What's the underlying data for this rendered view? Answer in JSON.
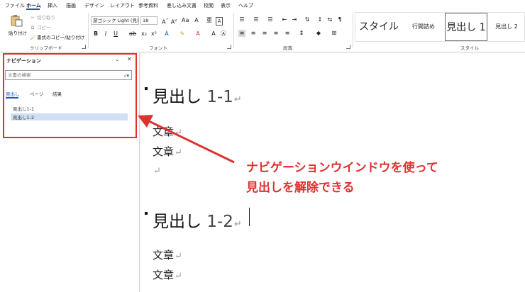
{
  "menu": {
    "tabs": [
      "ファイル",
      "ホーム",
      "挿入",
      "描画",
      "デザイン",
      "レイアウト",
      "参考資料",
      "差し込み文書",
      "校閲",
      "表示",
      "ヘルプ"
    ],
    "active_tab": "ホーム"
  },
  "clipboard": {
    "paste_label": "貼り付け",
    "cut_label": "切り取り",
    "copy_label": "コピー",
    "format_painter_label": "書式のコピー/貼り付け",
    "group_label": "クリップボード"
  },
  "font": {
    "font_name": "游ゴシック Light (見)",
    "font_size": "18",
    "group_label": "フォント"
  },
  "paragraph": {
    "group_label": "段落"
  },
  "styles": {
    "group_label": "スタイル",
    "items": [
      "スタイル",
      "行間詰め",
      "見出し 1",
      "見出し 2"
    ],
    "selected": "見出し 1"
  },
  "navigation": {
    "title": "ナビゲーション",
    "search_placeholder": "文書の検索",
    "tabs": [
      "見出し",
      "ページ",
      "結果"
    ],
    "active_tab": "見出し",
    "items": [
      "見出し1-1",
      "見出し1-2"
    ],
    "selected_item": "見出し1-2"
  },
  "document": {
    "heading1": {
      "text": "見出し",
      "num": "1-1"
    },
    "lines1": [
      "文章",
      "文章"
    ],
    "heading2": {
      "text": "見出し",
      "num": "1-2"
    },
    "lines2": [
      "文章",
      "文章"
    ],
    "paragraph_mark": "↵"
  },
  "annotation": {
    "line1": "ナビゲーションウインドウを使って",
    "line2": "見出しを解除できる",
    "color": "#e03131"
  },
  "colors": {
    "accent": "#185abd",
    "annotation": "#e03131",
    "nav_selected": "#cfe0f5"
  }
}
